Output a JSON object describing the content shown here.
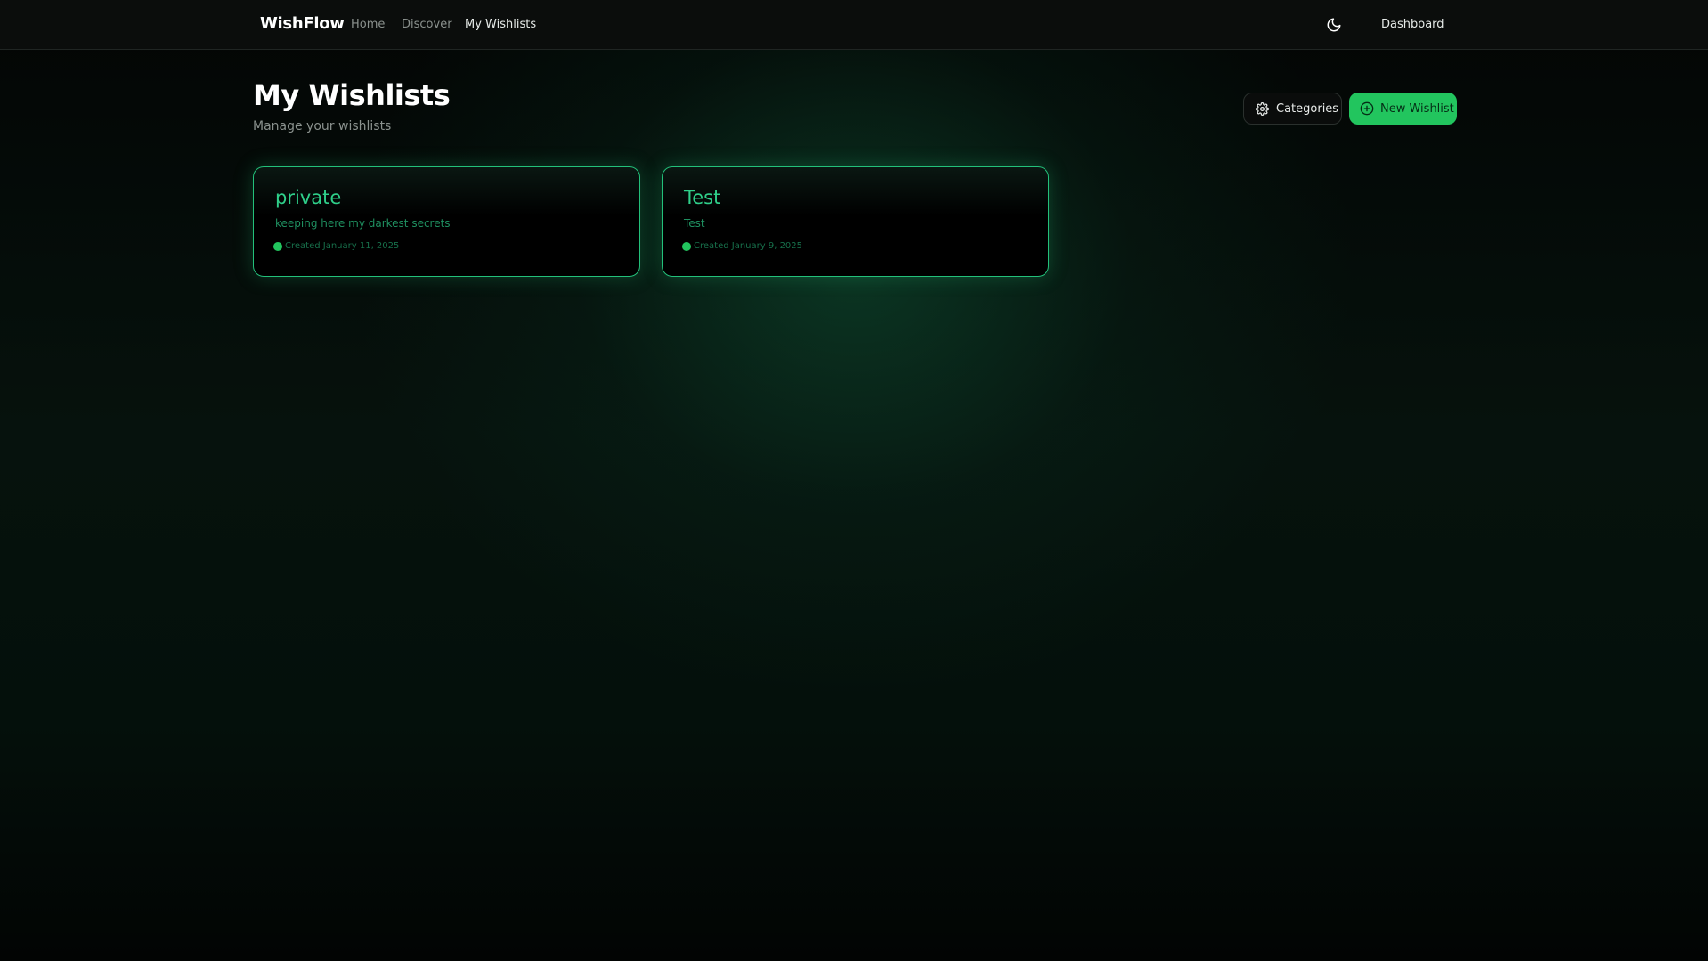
{
  "nav": {
    "brand": "WishFlow",
    "links": [
      "Home",
      "Discover",
      "My Wishlists"
    ],
    "active": "My Wishlists",
    "theme_icon": "moon-icon",
    "dashboard_label": "Dashboard"
  },
  "header": {
    "title": "My Wishlists",
    "subtitle": "Manage your wishlists",
    "categories_label": "Categories",
    "categories_icon": "gear-icon",
    "new_label": "New Wishlist",
    "new_icon": "plus-circle-icon"
  },
  "wishlists": [
    {
      "title": "private",
      "description": "keeping here my darkest secrets",
      "created": "Created January 11, 2025"
    },
    {
      "title": "Test",
      "description": "Test",
      "created": "Created January 9, 2025"
    }
  ],
  "colors": {
    "accent": "#22c55e",
    "card_title": "#2fd08a",
    "card_border": "#23c07a",
    "background": "#050806"
  }
}
